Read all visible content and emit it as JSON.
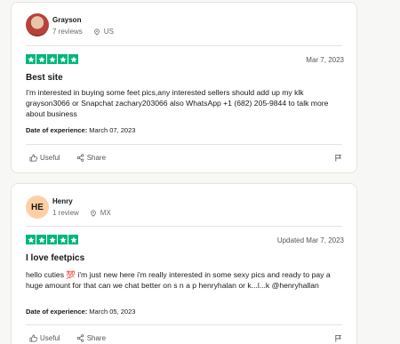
{
  "reviews": [
    {
      "name": "Grayson",
      "review_count": "7 reviews",
      "country": "US",
      "rating": 5,
      "date": "Mar 7, 2023",
      "title": "Best site",
      "body": "I'm interested in buying some feet pics,any interested sellers should add up my klk grayson3066 or Snapchat zachary203066 also WhatsApp +1 (682) 205-9844 to talk more about business",
      "exp_label": "Date of experience:",
      "exp_date": "March 07, 2023",
      "useful_label": "Useful",
      "share_label": "Share"
    },
    {
      "name": "Henry",
      "initials": "HE",
      "review_count": "1 review",
      "country": "MX",
      "rating": 5,
      "date": "Updated Mar 7, 2023",
      "title": "I love feetpics",
      "body": "hello cuties 💯 i'm just new here i'm really interested in some sexy pics and ready to pay a huge amount for that can we chat better on s n a p henryhalan or k...l...k @henryhallan",
      "exp_label": "Date of experience:",
      "exp_date": "March 05, 2023",
      "useful_label": "Useful",
      "share_label": "Share"
    }
  ],
  "colors": {
    "star_green": "#00b67a",
    "avatar_henry": "#ffcfa3"
  },
  "icons": [
    "location-pin-icon",
    "star-icon",
    "thumbs-up-icon",
    "share-icon",
    "flag-icon"
  ]
}
